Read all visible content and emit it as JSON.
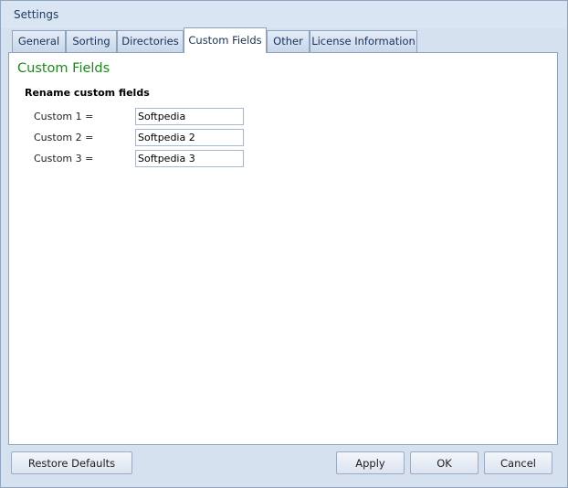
{
  "window": {
    "title": "Settings"
  },
  "tabs": [
    {
      "label": "General"
    },
    {
      "label": "Sorting"
    },
    {
      "label": "Directories"
    },
    {
      "label": "Custom Fields"
    },
    {
      "label": "Other"
    },
    {
      "label": "License Information"
    }
  ],
  "active_tab": "Custom Fields",
  "panel": {
    "title": "Custom Fields",
    "group_title": "Rename custom fields",
    "fields": [
      {
        "label": "Custom 1 =",
        "value": "Softpedia"
      },
      {
        "label": "Custom 2 =",
        "value": "Softpedia 2"
      },
      {
        "label": "Custom 3 =",
        "value": "Softpedia 3"
      }
    ]
  },
  "buttons": {
    "restore_defaults": "Restore Defaults",
    "apply": "Apply",
    "ok": "OK",
    "cancel": "Cancel"
  },
  "colors": {
    "accent_title": "#1b8a1b",
    "window_bg": "#d6e1ef",
    "tab_text": "#15315a"
  }
}
